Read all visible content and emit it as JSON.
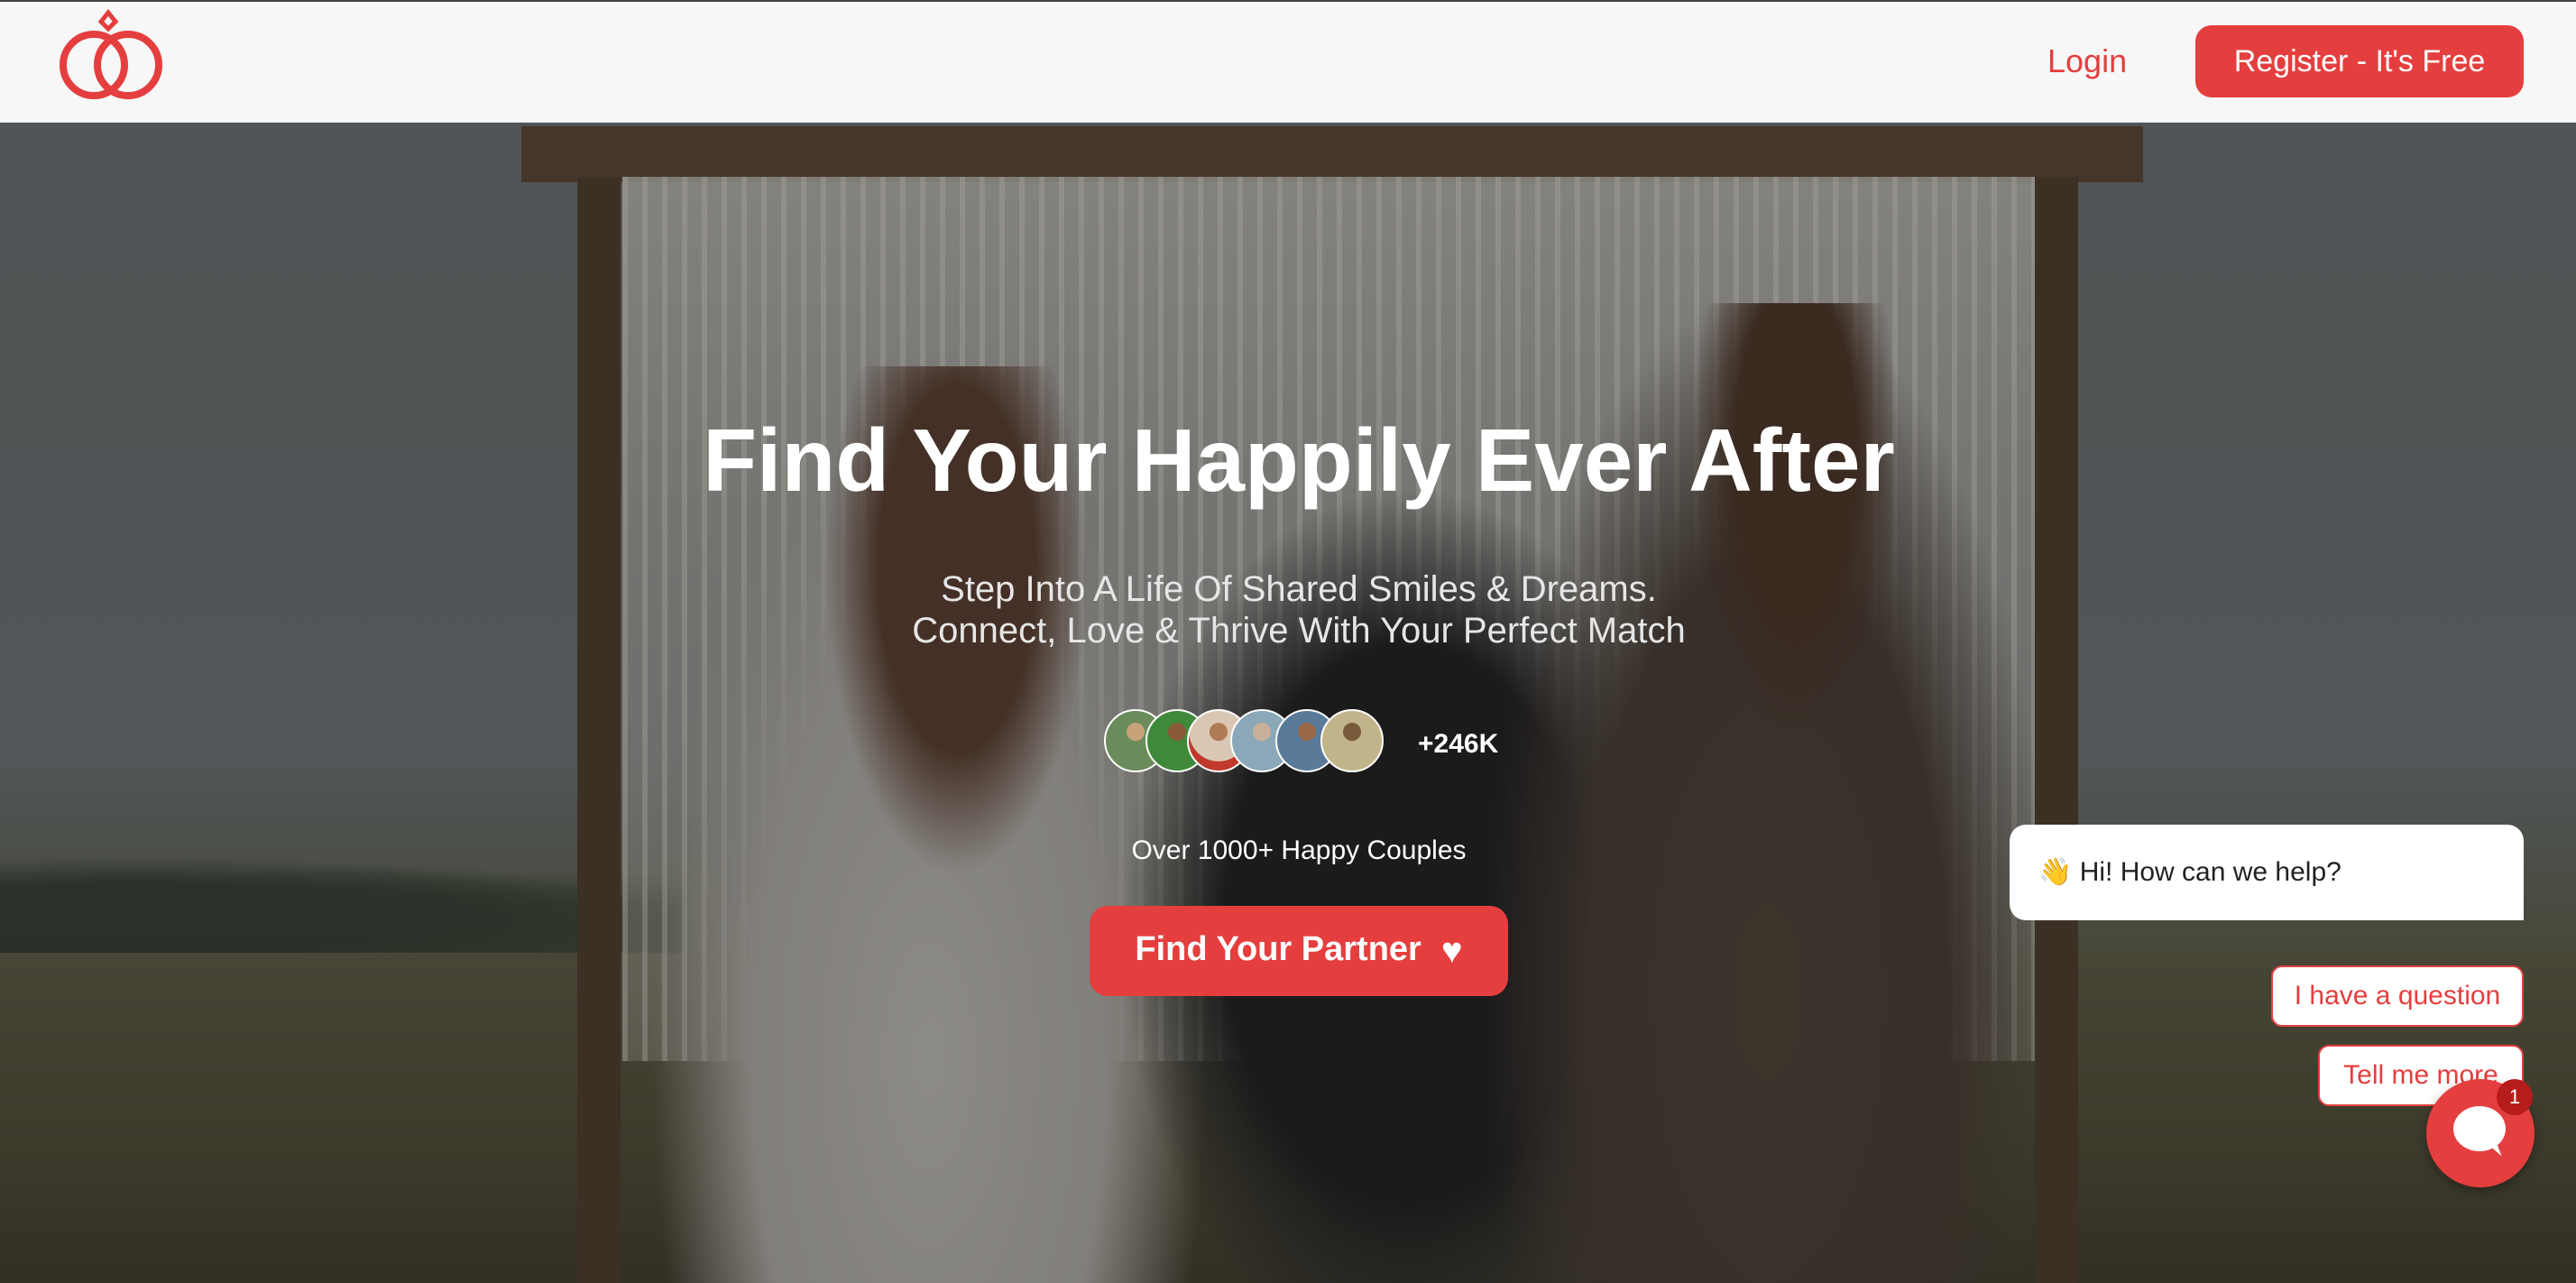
{
  "header": {
    "login_label": "Login",
    "register_label": "Register - It's Free"
  },
  "hero": {
    "title": "Find Your Happily Ever After",
    "subtitle_line1": "Step Into A Life Of Shared Smiles & Dreams.",
    "subtitle_line2": "Connect, Love & Thrive With Your Perfect Match",
    "member_count": "+246K",
    "couples_text": "Over 1000+ Happy Couples",
    "cta_label": "Find Your Partner",
    "cta_icon": "heart-icon"
  },
  "chat": {
    "greeting": "👋 Hi! How can we help?",
    "options": [
      "I have a question",
      "Tell me more"
    ],
    "unread_count": "1"
  },
  "colors": {
    "accent": "#e53e3e",
    "header_bg": "#f7f7f7"
  }
}
